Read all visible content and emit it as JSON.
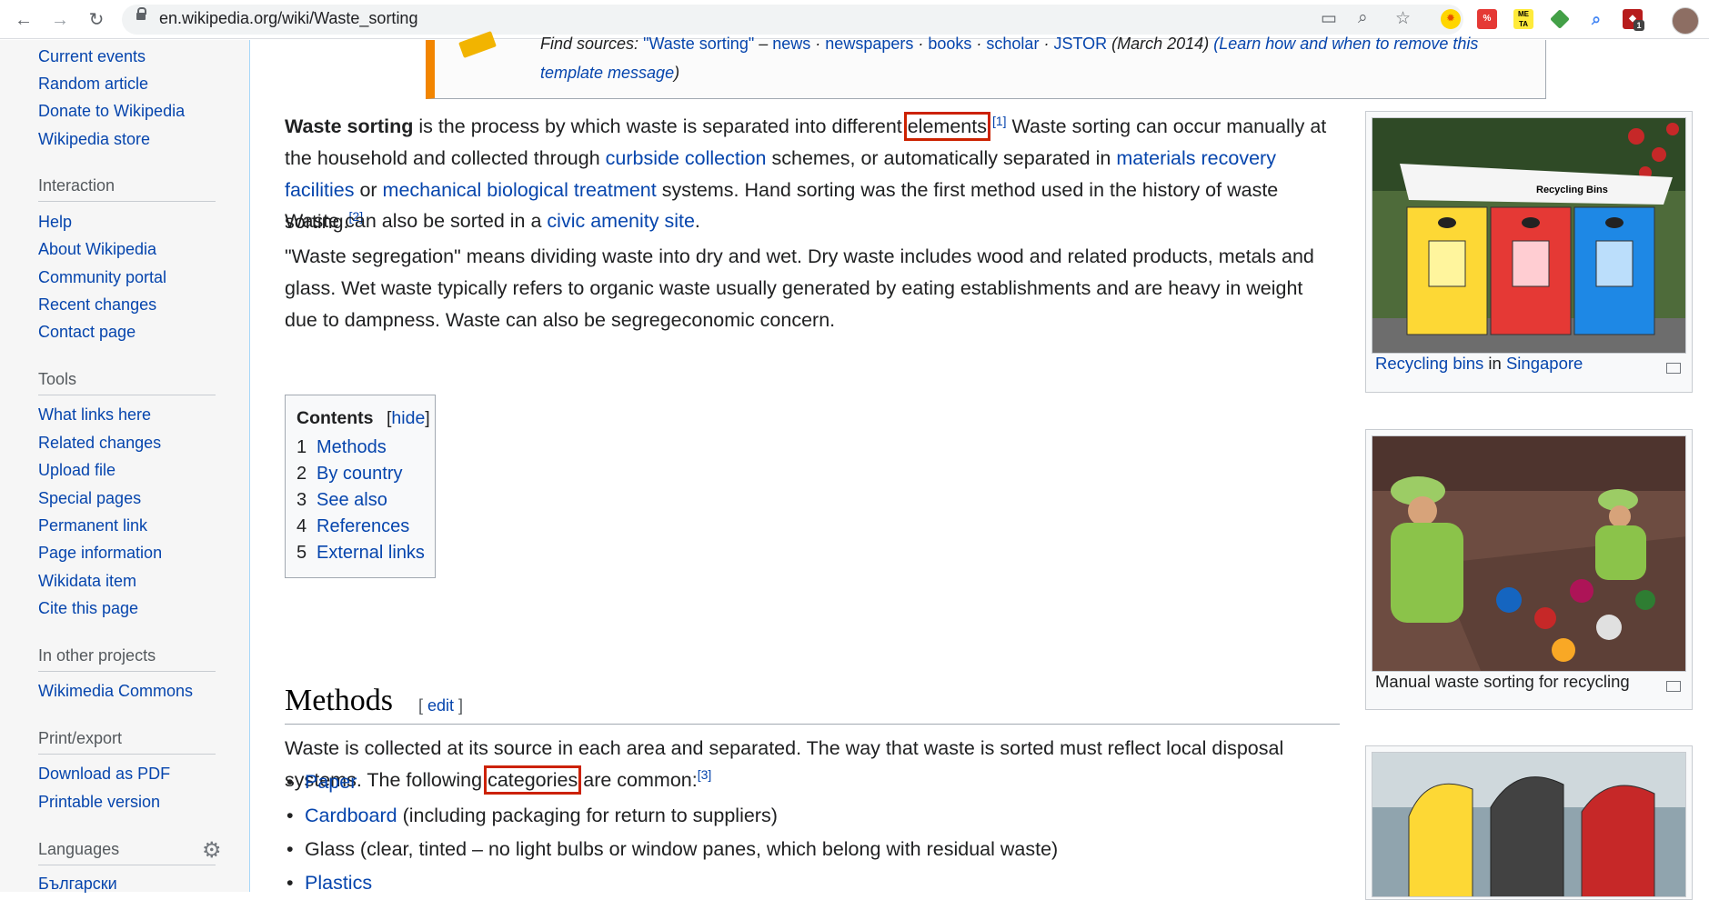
{
  "browser": {
    "url": "en.wikipedia.org/wiki/Waste_sorting"
  },
  "sidebar": {
    "top_links": [
      "Current events",
      "Random article",
      "Donate to Wikipedia",
      "Wikipedia store"
    ],
    "interaction_heading": "Interaction",
    "interaction_links": [
      "Help",
      "About Wikipedia",
      "Community portal",
      "Recent changes",
      "Contact page"
    ],
    "tools_heading": "Tools",
    "tools_links": [
      "What links here",
      "Related changes",
      "Upload file",
      "Special pages",
      "Permanent link",
      "Page information",
      "Wikidata item",
      "Cite this page"
    ],
    "projects_heading": "In other projects",
    "projects_links": [
      "Wikimedia Commons"
    ],
    "print_heading": "Print/export",
    "print_links": [
      "Download as PDF",
      "Printable version"
    ],
    "languages_heading": "Languages",
    "language_links": [
      "Български"
    ]
  },
  "ambox": {
    "find_sources": "Find sources:",
    "query": "\"Waste sorting\"",
    "dash": "–",
    "sources": [
      "news",
      "newspapers",
      "books",
      "scholar",
      "JSTOR"
    ],
    "date": "(March 2014)",
    "learn_link": "(Learn how and when to remove this",
    "learn_link_2": "template message",
    "learn_close": ")"
  },
  "intro": {
    "bold": "Waste sorting",
    "t1": " is the process by which waste is separated into different ",
    "elements": "elements",
    "t2": ".",
    "ref1": "[1]",
    "t3": " Waste sorting can occur manually at the household and collected through ",
    "curbside": "curbside collection",
    "t4": " schemes, or automatically separated in ",
    "mrf": "materials recovery facilities",
    "t5": " or ",
    "mbt": "mechanical biological treatment",
    "t6": " systems. Hand sorting was the first method used in the history of waste sorting.",
    "ref2": "[2]"
  },
  "para2": {
    "t1": "Waste can also be sorted in a ",
    "civic": "civic amenity site",
    "t2": "."
  },
  "para3": "\"Waste segregation\" means dividing waste into dry and wet. Dry waste includes wood and related products, metals and glass. Wet waste typically refers to organic waste usually generated by eating establishments and are heavy in weight due to dampness. Waste can also be segregeconomic concern.",
  "toc": {
    "title": "Contents",
    "hide_open": "[",
    "hide": "hide",
    "hide_close": "]",
    "items": [
      {
        "num": "1",
        "label": "Methods"
      },
      {
        "num": "2",
        "label": "By country"
      },
      {
        "num": "3",
        "label": "See also"
      },
      {
        "num": "4",
        "label": "References"
      },
      {
        "num": "5",
        "label": "External links"
      }
    ]
  },
  "methods": {
    "heading": "Methods",
    "edit_open": "[ ",
    "edit": "edit",
    "edit_close": " ]",
    "t1": "Waste is collected at its source in each area and separated. The way that waste is sorted must reflect local disposal systems. The following ",
    "categories": "categories",
    "t2": " are common:",
    "ref3": "[3]",
    "bullets": [
      {
        "link": "Paper",
        "rest": ""
      },
      {
        "link": "Cardboard",
        "rest": " (including packaging for return to suppliers)"
      },
      {
        "link": "",
        "rest": "Glass (clear, tinted – no light bulbs or window panes, which belong with residual waste)"
      },
      {
        "link": "Plastics",
        "rest": ""
      }
    ]
  },
  "thumbs": {
    "t1": {
      "link1": "Recycling bins",
      "mid": " in ",
      "link2": "Singapore",
      "sign": "Recycling Bins"
    },
    "t2": {
      "caption": "Manual waste sorting for recycling"
    }
  },
  "extensions": {
    "ext1": "%",
    "ext2": "ME TA",
    "badge": "1"
  }
}
